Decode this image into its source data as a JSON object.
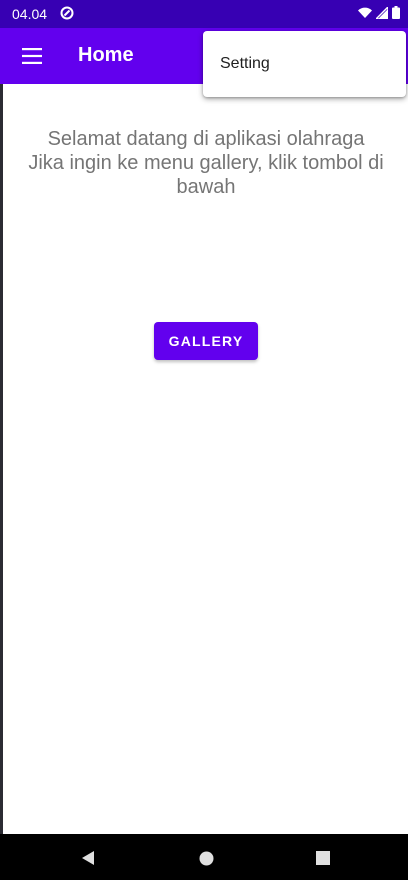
{
  "status_bar": {
    "time": "04.04",
    "icons": [
      "app-notification-icon",
      "wifi-icon",
      "signal-icon",
      "battery-icon"
    ]
  },
  "app_bar": {
    "menu_icon": "hamburger-menu-icon",
    "title": "Home"
  },
  "overflow_menu": {
    "items": [
      {
        "label": "Setting"
      }
    ]
  },
  "main": {
    "welcome_line1": "Selamat datang di aplikasi olahraga",
    "welcome_line2": "Jika ingin ke menu gallery, klik tombol di bawah",
    "gallery_button_label": "GALLERY"
  },
  "nav_bar": {
    "icons": [
      "back-icon",
      "home-icon",
      "recent-apps-icon"
    ]
  },
  "colors": {
    "status_bar": "#3700b3",
    "app_bar": "#6200ee",
    "button": "#6200ee",
    "body_text": "#757575"
  }
}
